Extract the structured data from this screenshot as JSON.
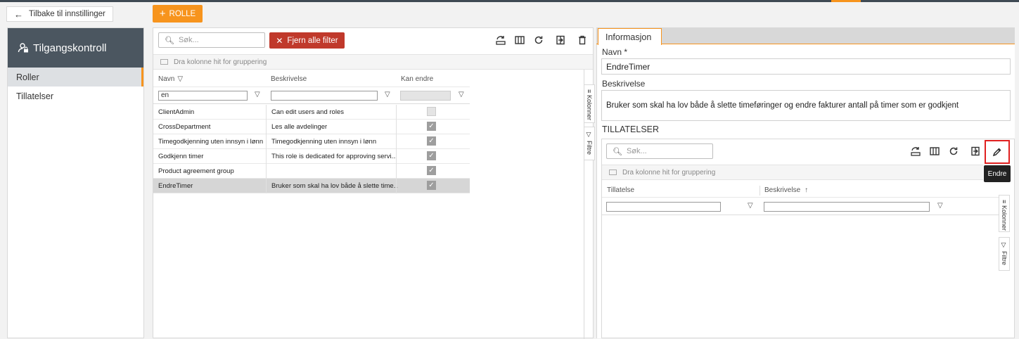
{
  "header": {
    "back_label": "Tilbake til innstillinger",
    "add_role_label": "ROLLE"
  },
  "sidebar": {
    "title": "Tilgangskontroll",
    "items": [
      {
        "label": "Roller",
        "selected": true
      },
      {
        "label": "Tillatelser",
        "selected": false
      }
    ]
  },
  "grid": {
    "search_placeholder": "Søk...",
    "clear_filters_label": "Fjern alle filter",
    "group_hint": "Dra kolonne hit for gruppering",
    "columns": [
      "Navn",
      "Beskrivelse",
      "Kan endre"
    ],
    "filter_name_value": "en",
    "rows": [
      {
        "name": "ClientAdmin",
        "desc": "Can edit users and roles",
        "can_edit": false,
        "selected": false
      },
      {
        "name": "CrossDepartment",
        "desc": "Les alle avdelinger",
        "can_edit": true,
        "selected": false
      },
      {
        "name": "Timegodkjenning uten innsyn i lønn",
        "desc": "Timegodkjenning uten innsyn i lønn",
        "can_edit": true,
        "selected": false
      },
      {
        "name": "Godkjenn timer",
        "desc": "This role is dedicated for approving servi...",
        "can_edit": true,
        "selected": false
      },
      {
        "name": "Product agreement group",
        "desc": "",
        "can_edit": true,
        "selected": false
      },
      {
        "name": "EndreTimer",
        "desc": "Bruker som skal ha lov både å slette time...",
        "can_edit": true,
        "selected": true
      }
    ],
    "side_tabs": [
      "Kolonner",
      "Filtre"
    ]
  },
  "detail": {
    "tab_label": "Informasjon",
    "name_label": "Navn *",
    "name_value": "EndreTimer",
    "desc_label": "Beskrivelse",
    "desc_value": "Bruker som skal ha lov både å slette timeføringer og endre fakturer antall på timer som er godkjent",
    "permissions_title": "TILLATELSER",
    "search_placeholder": "Søk...",
    "group_hint": "Dra kolonne hit for gruppering",
    "columns": [
      "Tillatelse",
      "Beskrivelse"
    ],
    "edit_tooltip": "Endre",
    "side_tabs": [
      "Kolonner",
      "Filtre"
    ]
  },
  "colors": {
    "accent": "#f7941d",
    "danger": "#c0392b",
    "sidebar_head": "#4b5660",
    "highlight": "#e02020"
  }
}
